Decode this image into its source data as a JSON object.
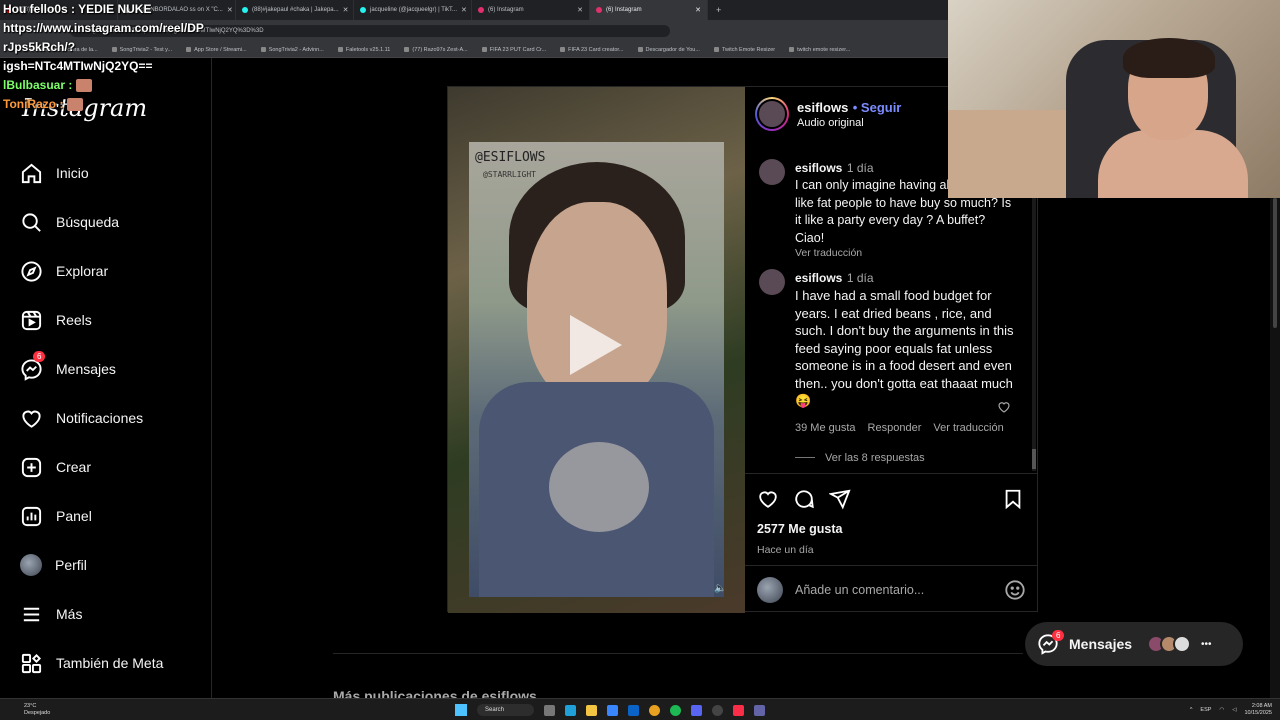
{
  "browser": {
    "tabs": [
      {
        "label": "(198) YouTube"
      },
      {
        "label": "(22) ENBORDALAO ss on X \"C..."
      },
      {
        "label": "(88)#jakepaul #chaka | Jakepa..."
      },
      {
        "label": "jacqueline (@jacqueelgr) | TikT..."
      },
      {
        "label": "(6) Instagram"
      },
      {
        "label": "(6) Instagram"
      }
    ],
    "url": "instagram.com/reel/DPJps5kRch/?igsh=NTc4MTIwNjQ2YQ%3D%3D",
    "bookmarks": [
      "Boxeador lectura de la...",
      "SongTrivia2 - Test y...",
      "App Store / Streami...",
      "SongTrivia2 - Advinn...",
      "Faletools v25.1.11",
      "(77) Razo97s Zest-A...",
      "FIFA 23 PUT Card Cr...",
      "FIFA 23 Card creator...",
      "Descargador de You...",
      "Twitch Emote Resizer",
      "twitch emote resizer..."
    ]
  },
  "stream_chat": {
    "line1": "Hou fello0s : YEDIE NUKE",
    "line2": "https://www.instagram.com/reel/DP",
    "line3": "rJps5kRch/?",
    "line4": "igsh=NTc4MTIwNjQ2YQ==",
    "line5_user": "lBulbasuar :",
    "line6_user": "ToniRazo :"
  },
  "sidebar": {
    "logo": "Instagram",
    "items": [
      {
        "label": "Inicio",
        "icon": "home-icon"
      },
      {
        "label": "Búsqueda",
        "icon": "search-icon"
      },
      {
        "label": "Explorar",
        "icon": "compass-icon"
      },
      {
        "label": "Reels",
        "icon": "reels-icon"
      },
      {
        "label": "Mensajes",
        "icon": "messenger-icon",
        "badge": "6"
      },
      {
        "label": "Notificaciones",
        "icon": "heart-icon"
      },
      {
        "label": "Crear",
        "icon": "plus-square-icon"
      },
      {
        "label": "Panel",
        "icon": "chart-icon"
      },
      {
        "label": "Perfil",
        "icon": "avatar"
      },
      {
        "label": "Más",
        "icon": "menu-icon"
      },
      {
        "label": "También de Meta",
        "icon": "meta-grid-icon"
      }
    ]
  },
  "post": {
    "video_tag": "@ESIFLOWS",
    "video_tag2": "@STARRLIGHT",
    "author": "esiflows",
    "follow": "• Seguir",
    "audio": "Audio original",
    "comments": [
      {
        "user": "esiflows",
        "time": "1 día",
        "text": "I can only imagine having all. What's it like fat people to have buy so much? Is it like a party every day ? A buffet? Ciao!",
        "translate": "Ver traducción"
      },
      {
        "user": "esiflows",
        "time": "1 día",
        "text": "I have had a small food budget for years. I eat dried beans , rice, and such. I don't buy the arguments in this feed saying poor equals fat unless someone is in a food desert and even then.. you don't gotta eat thaaat much 😝",
        "likes": "39 Me gusta",
        "reply": "Responder",
        "translate": "Ver traducción",
        "replies": "Ver las 8 respuestas"
      }
    ],
    "likes": "2577 Me gusta",
    "ago": "Hace un día",
    "comment_placeholder": "Añade un comentario..."
  },
  "more_title": "Más publicaciones de esiflows",
  "messages_pill": {
    "label": "Mensajes",
    "badge": "6"
  },
  "taskbar": {
    "temp": "23°C",
    "weather": "Despejado",
    "search": "Search",
    "lang": "ESP",
    "time": "2:08 AM",
    "date": "10/15/2025"
  }
}
